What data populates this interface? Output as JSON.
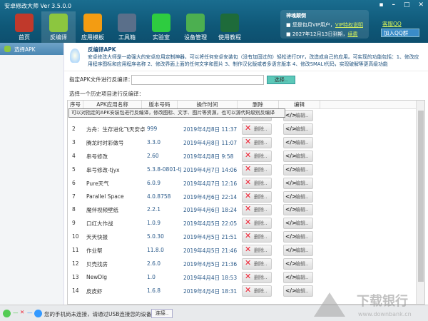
{
  "app": {
    "title": "安卓修改大师 Ver 3.5.0.0"
  },
  "toolbar": [
    {
      "label": "首页",
      "color": "#c0392b"
    },
    {
      "label": "反编译",
      "color": "#8cc63f"
    },
    {
      "label": "应用模板",
      "color": "#f39c12"
    },
    {
      "label": "工具箱",
      "color": "#5a6f8a"
    },
    {
      "label": "实验室",
      "color": "#2ecc40"
    },
    {
      "label": "设备管理",
      "color": "#4caf50"
    },
    {
      "label": "使用教程",
      "color": "#1e6b3a"
    }
  ],
  "vip": {
    "title": "神魂颠倒",
    "line1": "您是包月VIP用户，",
    "link1": "VIP特权说明",
    "line2": "2027年12月13日到期，",
    "link2": "续费"
  },
  "qq": {
    "service": "客服QQ",
    "group": "加入QQ群"
  },
  "sidebar": {
    "item": "选择APK"
  },
  "intro": {
    "title": "反编译APK",
    "text": "安卓修改大师是一款强大的安卓应用定制神器，可以将任何安卓安装包（没有加固过的）轻松进行DIY，改造成自己的应用。可实现的功能包括：1、修改应用程序图标和应用程序名称 2、修改界面上面的任何文字和图片 3、制作汉化版或者多语言版本 4、修改SMALI代码，实现破解等更高级功能"
  },
  "input": {
    "label": "指定APK文件进行反编译：",
    "value": "",
    "button": "选择.."
  },
  "history": {
    "label": "选择一个历史项目进行反编译：",
    "tooltip": "可以对指定的APK安装包进行反编译，修改图标、文字、图片等资源，也可以源代码级别反编译",
    "columns": [
      "序号",
      "APK应用名称",
      "版本号码",
      "操作时间",
      "删除",
      "编辑"
    ],
    "delete_label": "删除..",
    "edit_label": "编辑..",
    "rows": [
      [
        "2",
        "方舟：生存进化飞天安卓",
        "999",
        "2019年4月8日 11:37"
      ],
      [
        "3",
        "腾龙时时彩做号",
        "3.3.0",
        "2019年4月8日 11:07"
      ],
      [
        "4",
        "串号修改",
        "2.60",
        "2019年4月8日 9:58"
      ],
      [
        "5",
        "串号修改-tjyx",
        "5.3.8-0801-tj",
        "2019年4月7日 14:06"
      ],
      [
        "6",
        "Pure天气",
        "6.0.9",
        "2019年4月7日 12:16"
      ],
      [
        "7",
        "Parallel Space",
        "4.0.8758",
        "2019年4月6日 22:14"
      ],
      [
        "8",
        "魔伴视频壁纸",
        "2.2.1",
        "2019年4月6日 18:24"
      ],
      [
        "9",
        "口红大作战",
        "1.0.9",
        "2019年4月5日 22:05"
      ],
      [
        "10",
        "天天快报",
        "5.0.30",
        "2019年4月5日 21:51"
      ],
      [
        "11",
        "作业帮",
        "11.8.0",
        "2019年4月5日 21:46"
      ],
      [
        "12",
        "贝壳找房",
        "2.6.0",
        "2019年4月5日 21:36"
      ],
      [
        "13",
        "NewDlg",
        "1.0",
        "2019年4月4日 18:53"
      ],
      [
        "14",
        "皮皮虾",
        "1.6.8",
        "2019年4月4日 18:31"
      ]
    ]
  },
  "status": {
    "text": "您的手机尚未连接，请通过USB连接您的设备。",
    "connect": "连接.."
  },
  "watermark": {
    "name": "下载银行",
    "url": "www.downbank.cn"
  }
}
